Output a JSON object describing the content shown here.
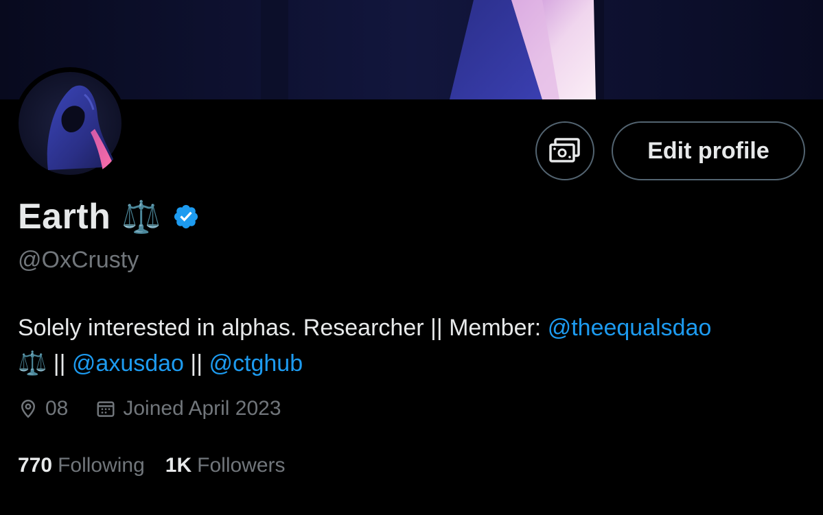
{
  "profile": {
    "display_name": "Earth",
    "name_emoji": "⚖️",
    "verified": true,
    "handle": "@OxCrusty",
    "bio": {
      "text_1": "Solely interested in alphas. Researcher || Member: ",
      "link_1": "@theequalsdao",
      "emoji": "⚖️",
      "sep_1": " || ",
      "link_2": "@axusdao",
      "sep_2": " || ",
      "link_3": "@ctghub"
    },
    "location": "08",
    "joined": "Joined April 2023",
    "following_count": "770",
    "following_label": "Following",
    "followers_count": "1K",
    "followers_label": "Followers"
  },
  "actions": {
    "edit_profile_label": "Edit profile",
    "tips_icon": "money-icon"
  },
  "colors": {
    "background": "#000000",
    "link": "#1d9bf0",
    "verified": "#1d9bf0",
    "muted": "#71767b",
    "primary_text": "#e7e9ea",
    "border": "#536471"
  }
}
